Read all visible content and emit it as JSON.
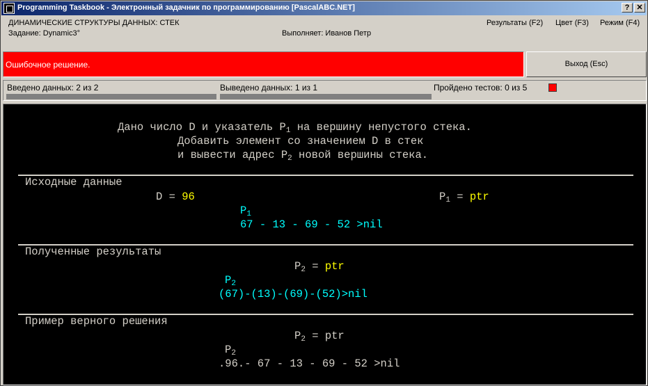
{
  "window": {
    "title": "Programming Taskbook - Электронный задачник по программированию [PascalABC.NET]",
    "help_button": "?",
    "close_button": "✕"
  },
  "header": {
    "topic": "ДИНАМИЧЕСКИЕ СТРУКТУРЫ ДАННЫХ: СТЕК",
    "task": "Задание: Dynamic3°",
    "executor": "Выполняет: Иванов Петр",
    "menu": {
      "results": "Результаты (F2)",
      "color": "Цвет (F3)",
      "mode": "Режим (F4)"
    }
  },
  "status": {
    "message": "Ошибочное решение.",
    "color": "#ff0000"
  },
  "exit_button": "Выход (Esc)",
  "counters": {
    "input": "Введено данных: 2 из 2",
    "output": "Выведено данных: 1 из 1",
    "tests": "Пройдено тестов: 0 из 5"
  },
  "console": {
    "task_text": {
      "line1_a": "Дано число D и указатель P",
      "line1_sub": "1",
      "line1_b": " на вершину непустого стека.",
      "line2": "Добавить элемент со значением D в стек",
      "line3_a": "и вывести адрес P",
      "line3_sub": "2",
      "line3_b": " новой вершины стека."
    },
    "input_section": {
      "header": "Исходные данные",
      "d_label": "D = ",
      "d_value": "96",
      "p1_label": "P",
      "p1_sub": "1",
      "p1_eq": " = ",
      "p1_value": "ptr",
      "pointer_label": "P",
      "pointer_sub": "1",
      "stack": "67 - 13 - 69 - 52 >nil"
    },
    "results_section": {
      "header": "Полученные результаты",
      "p2_label": "P",
      "p2_sub": "2",
      "p2_eq": " = ",
      "p2_value": "ptr",
      "pointer_label": "P",
      "pointer_sub": "2",
      "stack": "(67)-(13)-(69)-(52)>nil"
    },
    "example_section": {
      "header": "Пример верного решения",
      "p2_label": "P",
      "p2_sub": "2",
      "p2_eq": " = ptr",
      "pointer_label": "P",
      "pointer_sub": "2",
      "stack": ".96.- 67 - 13 - 69 - 52 >nil"
    }
  }
}
